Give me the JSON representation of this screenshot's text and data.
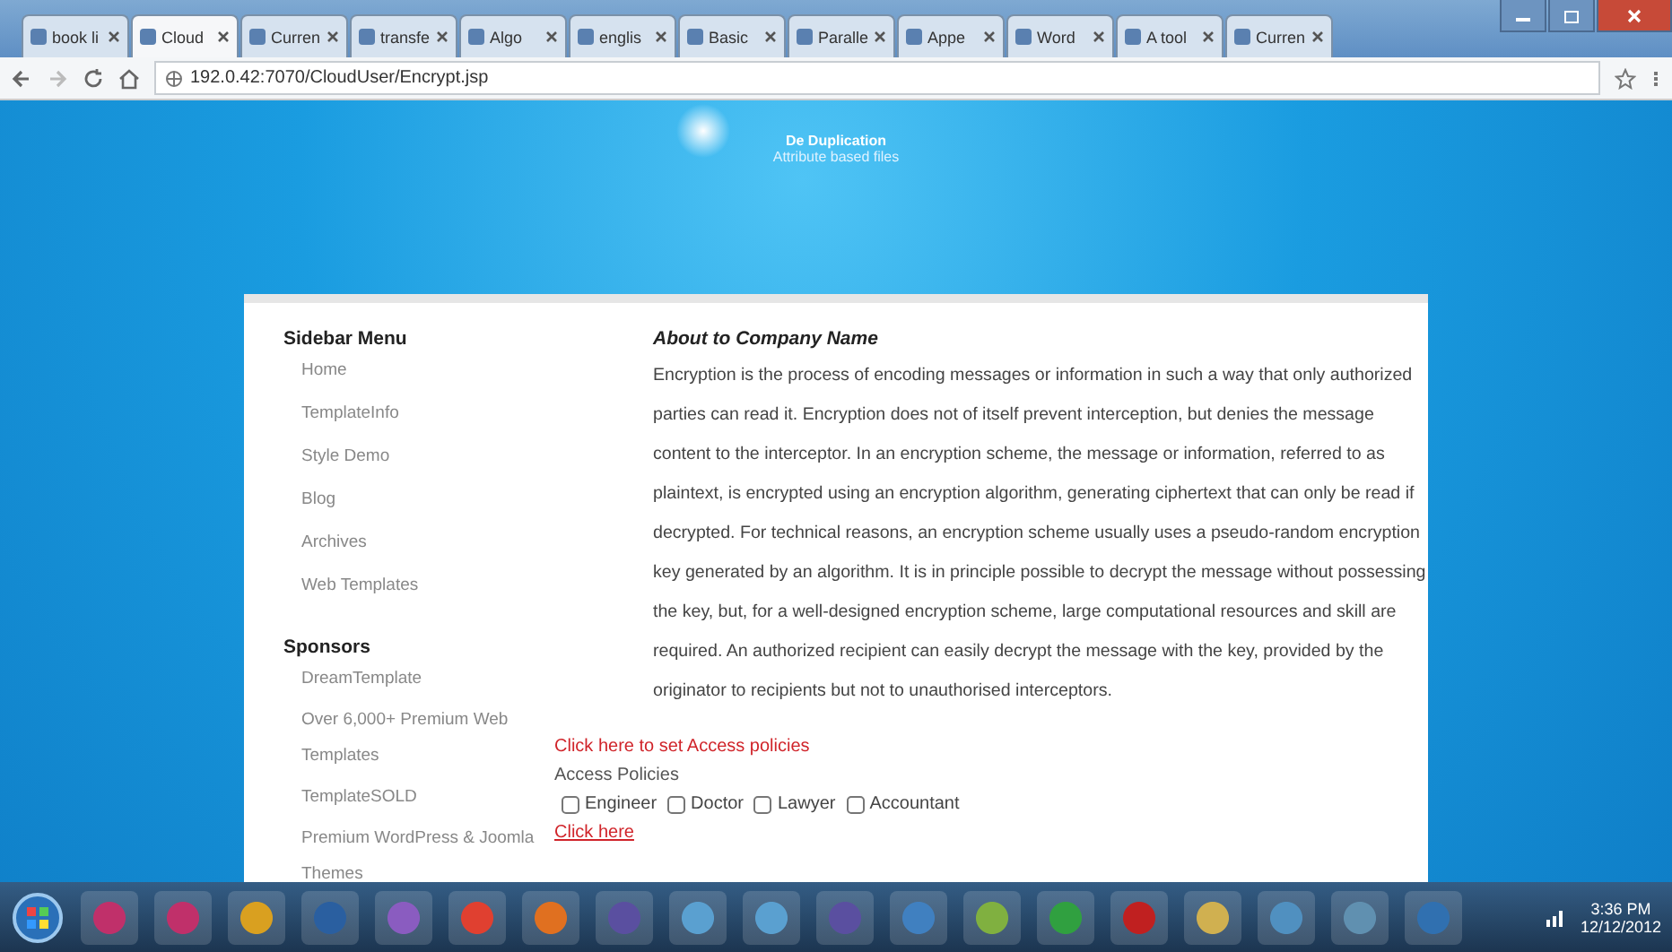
{
  "browser": {
    "tabs": [
      {
        "label": "book li",
        "selected": false
      },
      {
        "label": "Cloud",
        "selected": true
      },
      {
        "label": "Curren",
        "selected": false
      },
      {
        "label": "transfe",
        "selected": false
      },
      {
        "label": "Algo",
        "selected": false
      },
      {
        "label": "englis",
        "selected": false
      },
      {
        "label": "Basic",
        "selected": false
      },
      {
        "label": "Paralle",
        "selected": false
      },
      {
        "label": "Appe",
        "selected": false
      },
      {
        "label": "Word",
        "selected": false
      },
      {
        "label": "A tool",
        "selected": false
      },
      {
        "label": "Curren",
        "selected": false
      }
    ],
    "address": "192.0.42:7070/CloudUser/Encrypt.jsp"
  },
  "header": {
    "title": "De Duplication",
    "subtitle": "Attribute based files"
  },
  "sidebar": {
    "title": "Sidebar Menu",
    "items": [
      "Home",
      "TemplateInfo",
      "Style Demo",
      "Blog",
      "Archives",
      "Web Templates"
    ],
    "sponsors_title": "Sponsors",
    "sponsors": [
      "DreamTemplate",
      "Over 6,000+ Premium Web Templates",
      "TemplateSOLD",
      "Premium WordPress & Joomla Themes"
    ]
  },
  "main": {
    "title": "About to Company Name",
    "paragraph": "Encryption is the process of encoding messages or information in such a way that only authorized parties can read it. Encryption does not of itself prevent interception, but denies the message content to the interceptor. In an encryption scheme, the message or information, referred to as plaintext, is encrypted using an encryption algorithm, generating ciphertext that can only be read if decrypted. For technical reasons, an encryption scheme usually uses a pseudo-random encryption key generated by an algorithm. It is in principle possible to decrypt the message without possessing the key, but, for a well-designed encryption scheme, large computational resources and skill are required. An authorized recipient can easily decrypt the message with the key, provided by the originator to recipients but not to unauthorised interceptors.",
    "policy_link": "Click here to set Access policies",
    "policy_label": "Access Policies",
    "policies": [
      {
        "label": "Engineer",
        "checked": false
      },
      {
        "label": "Doctor",
        "checked": false
      },
      {
        "label": "Lawyer",
        "checked": false
      },
      {
        "label": "Accountant",
        "checked": false
      }
    ],
    "submit_link": "Click here"
  },
  "taskbar": {
    "time": "3:36 PM",
    "date": "12/12/2012"
  }
}
